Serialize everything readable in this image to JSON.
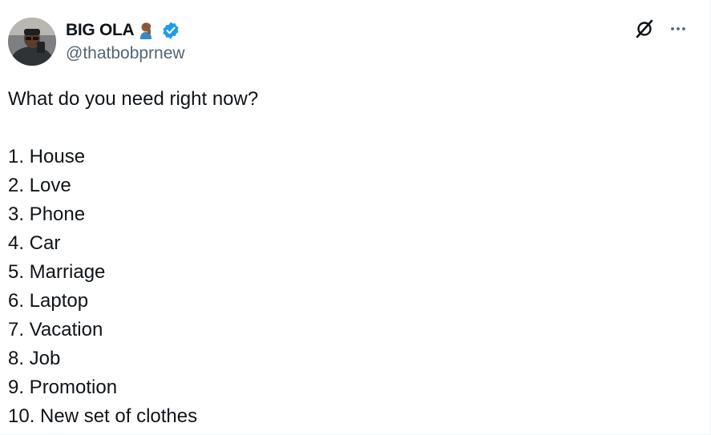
{
  "author": {
    "display_name": "BIG OLA",
    "handle": "@thatbobprnew",
    "name_emoji": "facepalm-emoji",
    "verified": true,
    "verified_color": "#1d9bf0"
  },
  "tweet": {
    "question": "What do you need right now?",
    "items": [
      "1. House",
      "2. Love",
      "3. Phone",
      "4. Car",
      "5. Marriage",
      "6. Laptop",
      "7. Vacation",
      "8. Job",
      "9. Promotion",
      "10. New set of clothes"
    ]
  },
  "actions": {
    "grok_icon": "grok-icon",
    "more_icon": "more-options-icon"
  },
  "colors": {
    "text": "#0f1419",
    "secondary": "#536471",
    "accent": "#1d9bf0"
  }
}
